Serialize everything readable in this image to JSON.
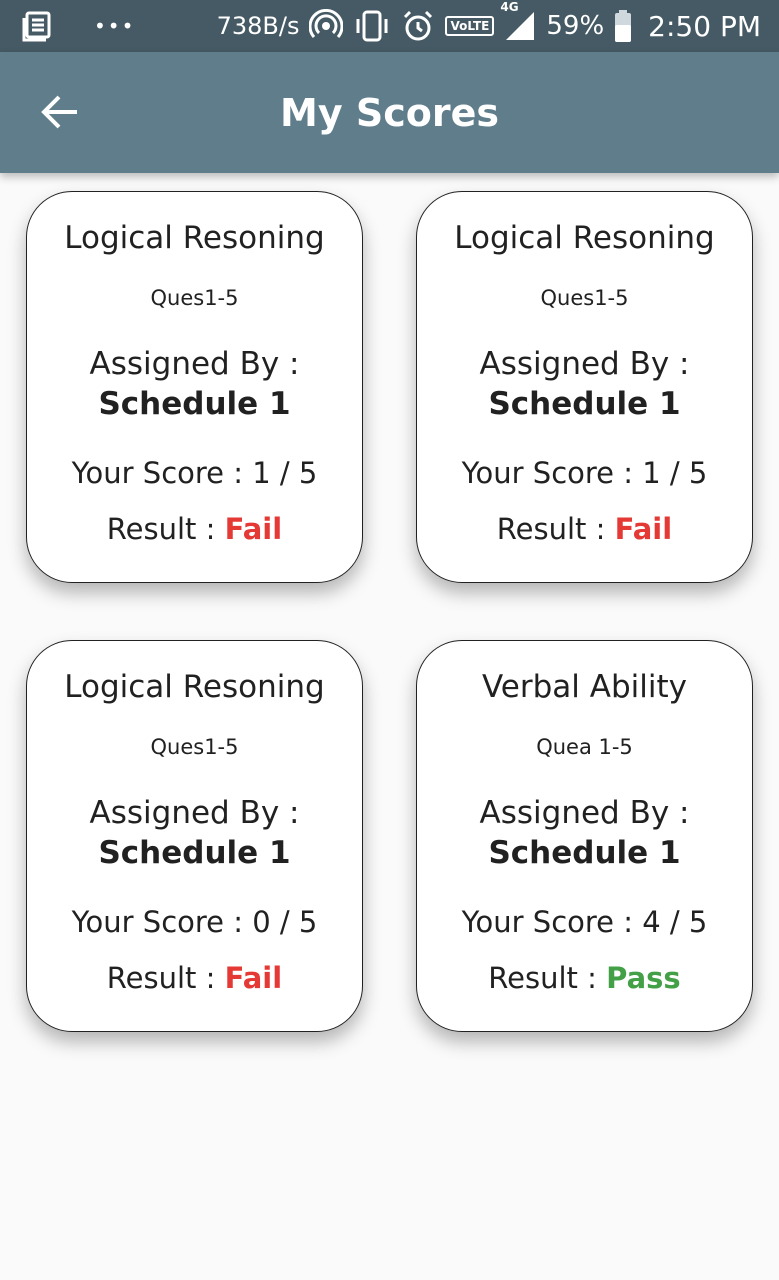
{
  "status_bar": {
    "net_speed": "738B/s",
    "battery": "59%",
    "time": "2:50 PM",
    "volte": "VoLTE",
    "network": "4G",
    "icons": [
      "news-icon",
      "more-dots-icon",
      "hotspot-icon",
      "vibrate-icon",
      "alarm-icon",
      "volte-icon",
      "signal-icon",
      "battery-icon"
    ]
  },
  "app_bar": {
    "title": "My Scores",
    "back_icon": "arrow-back-icon",
    "color": "#607d8b"
  },
  "colors": {
    "fail": "#e53935",
    "pass": "#43a047"
  },
  "cards": [
    {
      "title": "Logical Resoning",
      "questions": "Ques1-5",
      "assigned_label": "Assigned By :",
      "assigned_by": "Schedule 1",
      "score": "Your Score : 1 / 5",
      "result_label": "Result :",
      "result": "Fail"
    },
    {
      "title": "Logical Resoning",
      "questions": "Ques1-5",
      "assigned_label": "Assigned By :",
      "assigned_by": "Schedule 1",
      "score": "Your Score : 1 / 5",
      "result_label": "Result :",
      "result": "Fail"
    },
    {
      "title": "Logical Resoning",
      "questions": "Ques1-5",
      "assigned_label": "Assigned By :",
      "assigned_by": "Schedule 1",
      "score": "Your Score : 0 / 5",
      "result_label": "Result :",
      "result": "Fail"
    },
    {
      "title": "Verbal Ability",
      "questions": "Quea 1-5",
      "assigned_label": "Assigned By :",
      "assigned_by": "Schedule 1",
      "score": "Your Score : 4 / 5",
      "result_label": "Result :",
      "result": "Pass"
    }
  ]
}
